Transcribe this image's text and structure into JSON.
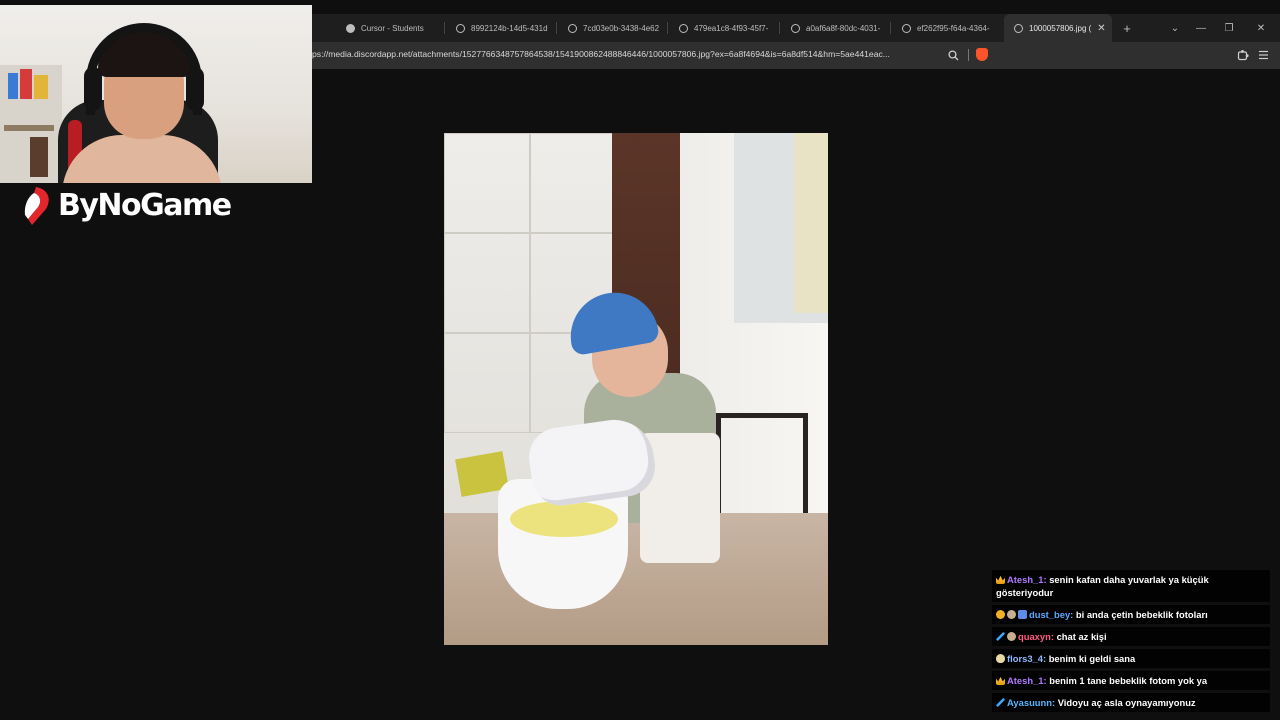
{
  "browser": {
    "tabs": [
      {
        "label": "Cursor - Students",
        "icon": "cursor-icon"
      },
      {
        "label": "8992124b-14d5-431d",
        "icon": "globe-icon"
      },
      {
        "label": "7cd03e0b-3438-4e62",
        "icon": "globe-icon"
      },
      {
        "label": "479ea1c8-4f93-45f7-",
        "icon": "globe-icon"
      },
      {
        "label": "a0af6a8f-80dc-4031-",
        "icon": "globe-icon"
      },
      {
        "label": "ef262f95-f64a-4364-",
        "icon": "globe-icon"
      },
      {
        "label": "1000057806.jpg (",
        "icon": "globe-icon",
        "active": true
      }
    ],
    "new_tab": "+",
    "tab_list": "⌄",
    "window_minimize": "—",
    "window_maximize": "❐",
    "window_close": "✕",
    "tab_close": "✕",
    "url": "ps://media.discordapp.net/attachments/1527766348757864538/1541900862488846446/1000057806.jpg?ex=6a8f4694&is=6a8df514&hm=5ae441eac...",
    "brand_color": "#fb542b"
  },
  "stream": {
    "logo_text": "ByNoGame",
    "logo_accent": "#e2262c"
  },
  "chat": {
    "messages": [
      {
        "badges": [
          "crown"
        ],
        "user": "Atesh_1",
        "user_color": "#b07aff",
        "text": "senin kafan daha yuvarlak ya küçük gösteriyodur"
      },
      {
        "badges": [
          "coin",
          "bear",
          "gift"
        ],
        "user": "dust_bey",
        "user_color": "#5aa8ff",
        "text": "bi anda çetin bebeklik fotoları"
      },
      {
        "badges": [
          "sword",
          "bear"
        ],
        "user": "quaxyn",
        "user_color": "#ff5b7f",
        "text": "chat az kişi"
      },
      {
        "badges": [
          "egg"
        ],
        "user": "flors3_4",
        "user_color": "#8fb9ff",
        "text": "benim ki geldi sana"
      },
      {
        "badges": [
          "crown"
        ],
        "user": "Atesh_1",
        "user_color": "#b07aff",
        "text": "benim 1 tane bebeklik fotom yok ya"
      },
      {
        "badges": [
          "sword"
        ],
        "user": "Ayasuunn",
        "user_color": "#58b4ff",
        "text": "Vidoyu aç asla oynayamıyonuz"
      }
    ]
  }
}
